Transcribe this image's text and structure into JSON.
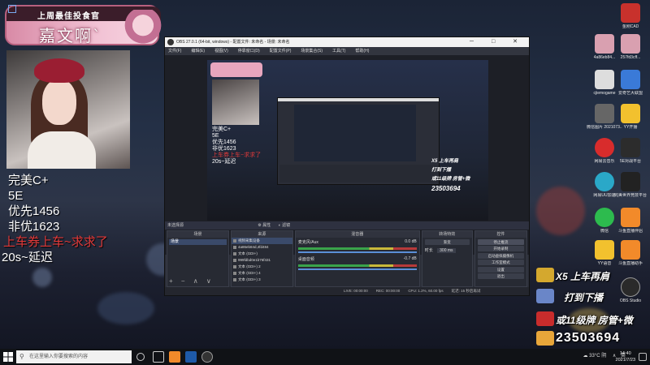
{
  "overlay": {
    "banner_title": "上周最佳投食官",
    "banner_name": "嘉文啊`",
    "lines_white": [
      "完美C+",
      "5E",
      "优先1456",
      "非优1623"
    ],
    "line_red": "上车券上车~求求了",
    "line_bottom": "20s~延迟"
  },
  "desktop_icons": [
    {
      "label": "金刚CAD",
      "color": "#c8312c"
    },
    {
      "label": "4a86eb84...",
      "color": "#d9a0b0"
    },
    {
      "label": "257fd3cff...",
      "color": "#d9a0b0"
    },
    {
      "label": "cjiemogame",
      "color": "#dddddd"
    },
    {
      "label": "爱奇艺大联盟",
      "color": "#3a7ad8"
    },
    {
      "label": "微信图片 2021073...",
      "color": "#666666"
    },
    {
      "label": "YY开播",
      "color": "#f2c12e"
    },
    {
      "label": "网易云音乐",
      "color": "#d82c2c"
    },
    {
      "label": "5E对战平台",
      "color": "#2c2c2c"
    },
    {
      "label": "网易UU加速",
      "color": "#2aa8c8"
    },
    {
      "label": "完美世界竞技平台",
      "color": "#222222"
    },
    {
      "label": "微信",
      "color": "#2dbb4e"
    },
    {
      "label": "斗鱼直播伴侣",
      "color": "#f28a2a"
    },
    {
      "label": "YY语音",
      "color": "#f2c12e"
    },
    {
      "label": "斗鱼直播助手",
      "color": "#f28a2a"
    },
    {
      "label": "OBS Studio",
      "color": "#2a2a2a"
    }
  ],
  "obs": {
    "title": "OBS 27.0.1 (64-bit, windows) - 配置文件: 未命名 - 场景: 未命名",
    "menu": [
      "文件(F)",
      "编辑(E)",
      "视图(V)",
      "停靠窗口(D)",
      "配置文件(P)",
      "场景集合(S)",
      "工具(T)",
      "帮助(H)"
    ],
    "no_source": "未选择源",
    "props_label": "属性",
    "filters_label": "滤镜",
    "docks": {
      "scenes": "场景",
      "sources": "来源",
      "mixer": "混音器",
      "transitions": "转场特效",
      "controls": "控件"
    },
    "scene_selected": "场景",
    "sources": [
      {
        "name": "视频采集设备",
        "selected": true
      },
      {
        "name": "4a86eb84d,4fd484",
        "selected": false
      },
      {
        "name": "文本 (GDI+)",
        "selected": false
      },
      {
        "name": "999fdbd0e1b76f431",
        "selected": false
      },
      {
        "name": "文本 (GDI+) 2",
        "selected": false
      },
      {
        "name": "文本 (GDI+) 4",
        "selected": false
      },
      {
        "name": "文本 (GDI+) 3",
        "selected": false
      }
    ],
    "mixer_channels": [
      {
        "name": "麦克风/Aux",
        "db": "0.0 dB"
      },
      {
        "name": "桌面音频",
        "db": "-0.7 dB"
      }
    ],
    "transition": {
      "type": "渐变",
      "duration_label": "时长",
      "duration": "300 ms"
    },
    "controls": [
      "停止推流",
      "开始录制",
      "启动虚拟摄像机",
      "工作室模式",
      "设置",
      "退出"
    ],
    "status": [
      "LIVE: 00:00:00",
      "REC: 00:00:00",
      "CPU: 1.2%, 60.00 fps",
      "延迟: 15 秒后再试"
    ]
  },
  "right_overlay": {
    "line1": "X5  上车再肩",
    "line2": "打到下播",
    "line3": "或11级牌  房管+微",
    "line4": "23503694"
  },
  "taskbar": {
    "search_placeholder": "在这里输入你要搜索的内容",
    "weather": "33°C 阴",
    "ime": "英",
    "time": "14:40",
    "date": "2021/7/23"
  }
}
